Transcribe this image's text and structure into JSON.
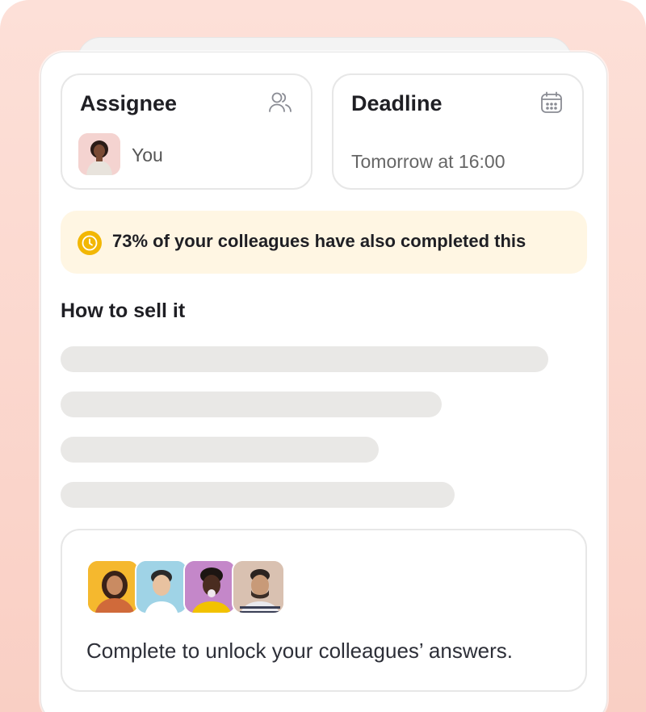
{
  "assignee": {
    "title": "Assignee",
    "icon": "users-icon",
    "value": "You"
  },
  "deadline": {
    "title": "Deadline",
    "icon": "calendar-icon",
    "value": "Tomorrow at 16:00"
  },
  "banner": {
    "icon": "clock-icon",
    "text": "73% of your colleagues have also completed this",
    "accent": "#f2b705",
    "background": "#fff6e3"
  },
  "section": {
    "title": "How to sell it",
    "placeholder_lines": 4
  },
  "unlock": {
    "text": "Complete to unlock your colleagues’ answers.",
    "avatars": [
      "colleague-avatar",
      "colleague-avatar",
      "colleague-avatar",
      "colleague-avatar"
    ]
  },
  "colors": {
    "background": "#fde0d8",
    "card": "#ffffff",
    "border": "#e7e7e7",
    "skeleton": "#e9e8e6",
    "text": "#1f1f24"
  }
}
